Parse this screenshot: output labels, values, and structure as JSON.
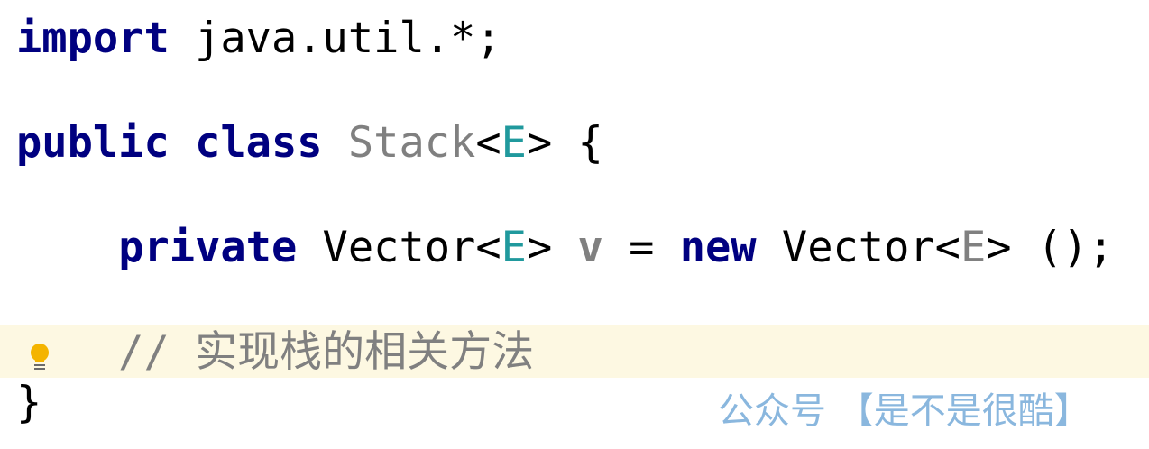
{
  "editor": {
    "language": "java",
    "lines": [
      {
        "tokens": [
          {
            "text": "import",
            "role": "keyword"
          },
          {
            "text": " java.util.*;",
            "role": "plain"
          }
        ]
      },
      {
        "tokens": [
          {
            "text": "public",
            "role": "keyword"
          },
          {
            "text": " ",
            "role": "plain"
          },
          {
            "text": "class",
            "role": "keyword"
          },
          {
            "text": " ",
            "role": "plain"
          },
          {
            "text": "Stack",
            "role": "unused_class"
          },
          {
            "text": "<",
            "role": "plain"
          },
          {
            "text": "E",
            "role": "type_param"
          },
          {
            "text": "> {",
            "role": "plain"
          }
        ]
      },
      {
        "tokens": [
          {
            "text": "    ",
            "role": "plain"
          },
          {
            "text": "private",
            "role": "keyword"
          },
          {
            "text": " Vector<",
            "role": "plain"
          },
          {
            "text": "E",
            "role": "type_param"
          },
          {
            "text": "> ",
            "role": "plain"
          },
          {
            "text": "v",
            "role": "unused_field"
          },
          {
            "text": " = ",
            "role": "plain"
          },
          {
            "text": "new",
            "role": "keyword"
          },
          {
            "text": " Vector<",
            "role": "plain"
          },
          {
            "text": "E",
            "role": "unused_type_param"
          },
          {
            "text": "> ();",
            "role": "plain"
          }
        ]
      },
      {
        "tokens": [
          {
            "text": "    // ",
            "role": "comment"
          },
          {
            "text": "实现栈的相关方法",
            "role": "comment_cjk"
          }
        ]
      },
      {
        "tokens": [
          {
            "text": "}",
            "role": "plain"
          }
        ]
      }
    ],
    "gutter_icon": "lightbulb-icon",
    "caret_line_highlight": "#fdf8e2"
  },
  "colors": {
    "keyword": "#000080",
    "unused": "#808080",
    "type_param": "#20999d",
    "comment": "#808080",
    "watermark": "#8ab7de",
    "bulb": "#f4b400"
  },
  "watermark": {
    "text": "公众号 【是不是很酷】"
  }
}
